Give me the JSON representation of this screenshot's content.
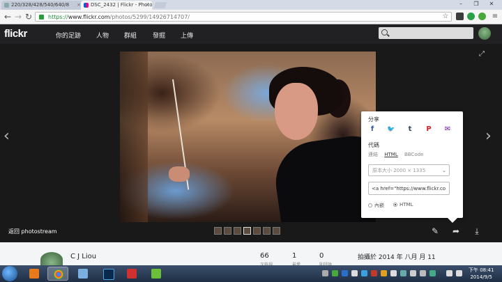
{
  "browser": {
    "tabs": [
      {
        "label": "220/328/428/540/640/8"
      },
      {
        "label": "DSC_2432 | Flickr - Photo"
      }
    ],
    "url_scheme": "https://",
    "url_host": "www.flickr.com",
    "url_path": "/photos/5299/14926714707/"
  },
  "flickr": {
    "logo": "flickr",
    "nav": [
      "你的足跡",
      "人物",
      "群組",
      "發掘",
      "上傳"
    ],
    "search_placeholder": ""
  },
  "photo": {
    "back_label": "返回 photostream"
  },
  "share": {
    "title": "分享",
    "social": [
      {
        "icon": "facebook-icon",
        "glyph": "f",
        "color": "#3b5998"
      },
      {
        "icon": "twitter-icon",
        "glyph": "🐦",
        "color": "#1da1f2"
      },
      {
        "icon": "tumblr-icon",
        "glyph": "t",
        "color": "#36465d"
      },
      {
        "icon": "pinterest-icon",
        "glyph": "P",
        "color": "#cb2027"
      },
      {
        "icon": "email-icon",
        "glyph": "✉",
        "color": "#6a1b9a"
      }
    ],
    "code_title": "代碼",
    "code_tabs": [
      "連結",
      "HTML",
      "BBCode"
    ],
    "active_tab": "HTML",
    "size_option": "原本大小 2000 × 1335",
    "code_value": "<a href=\"https://www.flickr.co",
    "radio_inline": "內嵌",
    "radio_html": "HTML"
  },
  "info": {
    "owner": "C J Liou",
    "stats": [
      {
        "value": "66",
        "label": "次檢視"
      },
      {
        "value": "1",
        "label": "最愛"
      },
      {
        "value": "0",
        "label": "則評論"
      }
    ],
    "taken": "拍攝於 2014 年 八月 月 11"
  },
  "taskbar": {
    "time": "下午 08:41",
    "date": "2014/9/5"
  }
}
